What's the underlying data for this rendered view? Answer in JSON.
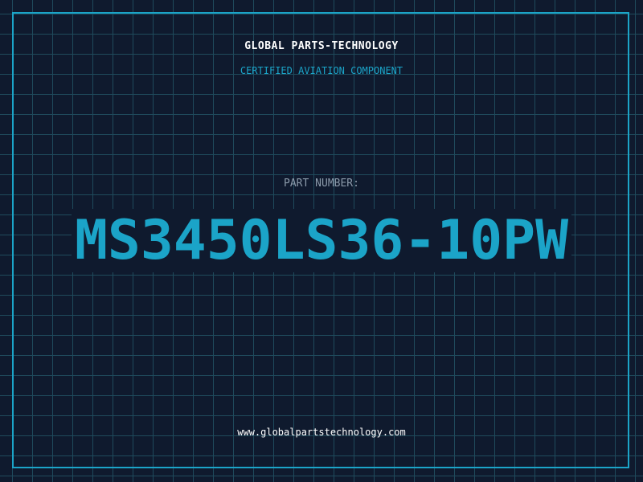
{
  "header": {
    "company": "GLOBAL PARTS-TECHNOLOGY",
    "subtitle": "CERTIFIED AVIATION COMPONENT"
  },
  "part": {
    "label": "PART NUMBER:",
    "number": "MS3450LS36-10PW"
  },
  "footer": {
    "website": "www.globalpartstechnology.com"
  },
  "colors": {
    "background": "#0f1a2e",
    "accent": "#1ba4c8",
    "grid": "#1f4a5c",
    "muted": "#8c9bab",
    "text": "#ffffff"
  }
}
